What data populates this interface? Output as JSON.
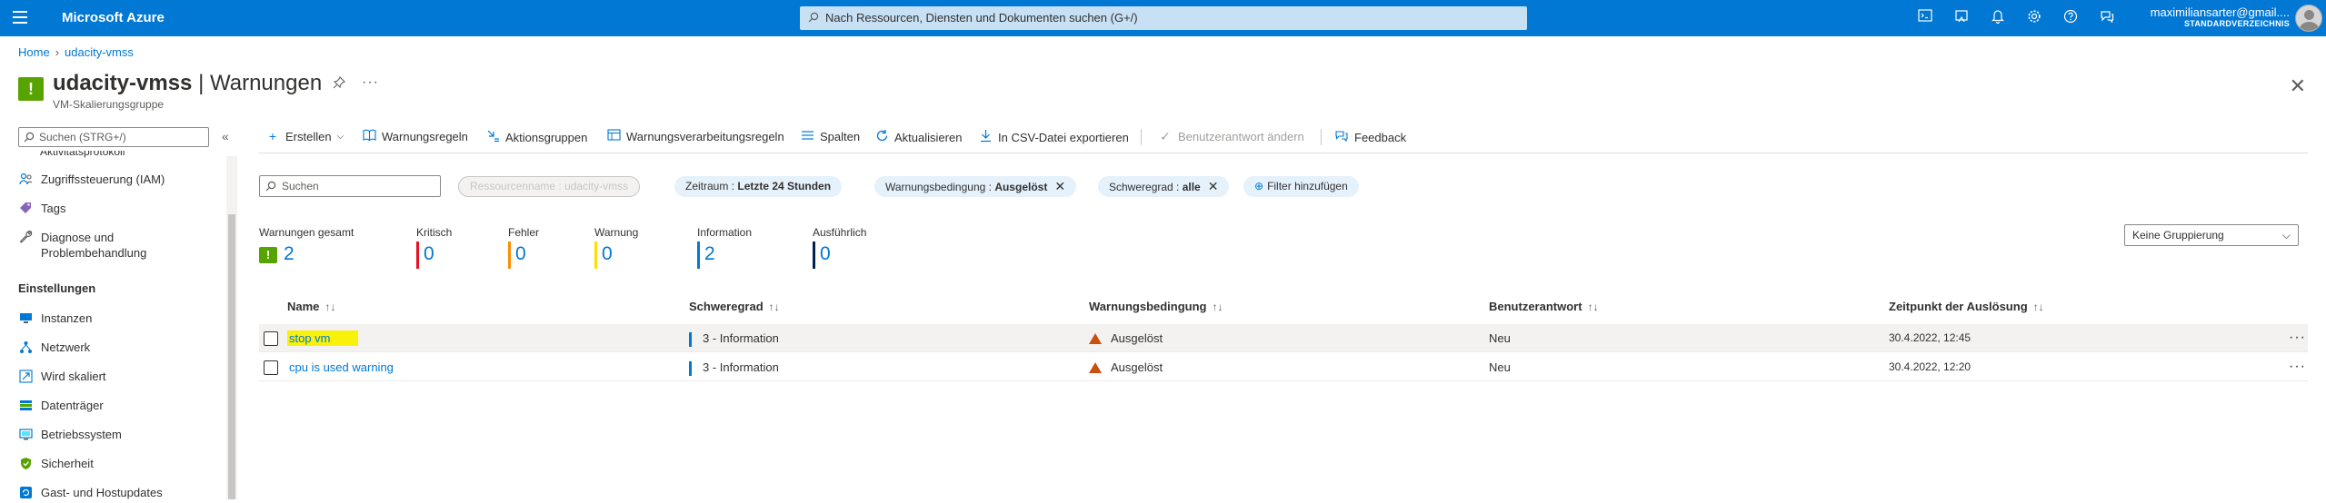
{
  "topbar": {
    "brand": "Microsoft Azure",
    "search_placeholder": "Nach Ressourcen, Diensten und Dokumenten suchen (G+/)",
    "user_name": "maximiliansarter@gmail....",
    "user_directory": "STANDARDVERZEICHNIS",
    "icons": [
      "cloud-shell-icon",
      "directory-filter-icon",
      "bell-icon",
      "gear-icon",
      "help-icon",
      "feedback-icon"
    ]
  },
  "breadcrumb": {
    "home": "Home",
    "current": "udacity-vmss"
  },
  "header": {
    "resource": "udacity-vmss",
    "separator": " | ",
    "page": "Warnungen",
    "subtitle": "VM-Skalierungsgruppe"
  },
  "sidebar": {
    "search_placeholder": "Suchen (STRG+/)",
    "cut_item": "Aktivitätsprotokoll",
    "items_top": [
      {
        "label": "Zugriffssteuerung (IAM)",
        "icon": "people-icon"
      },
      {
        "label": "Tags",
        "icon": "tag-icon"
      },
      {
        "label": "Diagnose und",
        "label2": "Problembehandlung",
        "icon": "wrench-icon"
      }
    ],
    "group": "Einstellungen",
    "items": [
      {
        "label": "Instanzen",
        "icon": "monitor-icon"
      },
      {
        "label": "Netzwerk",
        "icon": "network-icon"
      },
      {
        "label": "Wird skaliert",
        "icon": "scale-icon"
      },
      {
        "label": "Datenträger",
        "icon": "disk-icon"
      },
      {
        "label": "Betriebssystem",
        "icon": "os-icon"
      },
      {
        "label": "Sicherheit",
        "icon": "shield-icon"
      },
      {
        "label": "Gast- und Hostupdates",
        "icon": "updates-icon"
      }
    ]
  },
  "toolbar": {
    "create": "Erstellen",
    "alert_rules": "Warnungsregeln",
    "action_groups": "Aktionsgruppen",
    "processing_rules": "Warnungsverarbeitungsregeln",
    "columns": "Spalten",
    "refresh": "Aktualisieren",
    "export_csv": "In CSV-Datei exportieren",
    "change_response": "Benutzerantwort ändern",
    "feedback": "Feedback"
  },
  "filters": {
    "search_placeholder": "Suchen",
    "resource_name_label": "Ressourcenname : ",
    "resource_name_value": "udacity-vmss",
    "timerange_label": "Zeitraum : ",
    "timerange_value": "Letzte 24 Stunden",
    "condition_label": "Warnungsbedingung : ",
    "condition_value": "Ausgelöst",
    "severity_label": "Schweregrad : ",
    "severity_value": "alle",
    "add_filter": "Filter hinzufügen"
  },
  "summary": {
    "total": {
      "label": "Warnungen gesamt",
      "value": "2"
    },
    "critical": {
      "label": "Kritisch",
      "value": "0",
      "color": "#e81123"
    },
    "error": {
      "label": "Fehler",
      "value": "0",
      "color": "#ff8c00"
    },
    "warning": {
      "label": "Warnung",
      "value": "0",
      "color": "#fce100"
    },
    "information": {
      "label": "Information",
      "value": "2",
      "color": "#0078d4"
    },
    "verbose": {
      "label": "Ausführlich",
      "value": "0",
      "color": "#002050"
    },
    "grouping": "Keine Gruppierung"
  },
  "table": {
    "columns": [
      "Name",
      "Schweregrad",
      "Warnungsbedingung",
      "Benutzerantwort",
      "Zeitpunkt der Auslösung"
    ],
    "rows": [
      {
        "name": "stop vm",
        "severity": "3 - Information",
        "condition": "Ausgelöst",
        "response": "Neu",
        "time": "30.4.2022, 12:45"
      },
      {
        "name": "cpu is used warning",
        "severity": "3 - Information",
        "condition": "Ausgelöst",
        "response": "Neu",
        "time": "30.4.2022, 12:20"
      }
    ]
  }
}
